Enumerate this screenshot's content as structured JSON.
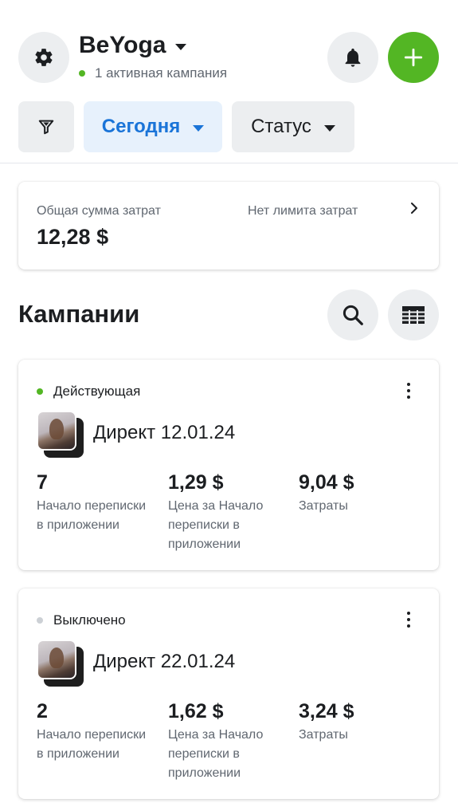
{
  "header": {
    "app_name": "BeYoga",
    "active_campaigns": "1 активная кампания",
    "settings_icon": "gear-icon",
    "notifications_icon": "bell-icon",
    "add_icon": "plus-icon"
  },
  "filters": {
    "filter_icon": "funnel-icon",
    "date_range": "Сегодня",
    "status": "Статус"
  },
  "summary": {
    "label": "Общая сумма затрат",
    "value": "12,28 $",
    "limit_text": "Нет лимита затрат"
  },
  "campaigns_section": {
    "title": "Кампании",
    "search_icon": "search-icon",
    "table_icon": "table-icon"
  },
  "campaigns": [
    {
      "status": "Действующая",
      "status_color": "#53b624",
      "name": "Директ 12.01.24",
      "metrics": [
        {
          "value": "7",
          "label": "Начало переписки в приложении"
        },
        {
          "value": "1,29 $",
          "label": "Цена за Начало переписки в приложении"
        },
        {
          "value": "9,04 $",
          "label": "Затраты"
        }
      ]
    },
    {
      "status": "Выключено",
      "status_color": "#ccd0d5",
      "name": "Директ 22.01.24",
      "metrics": [
        {
          "value": "2",
          "label": "Начало переписки в приложении"
        },
        {
          "value": "1,62 $",
          "label": "Цена за Начало переписки в приложении"
        },
        {
          "value": "3,24 $",
          "label": "Затраты"
        }
      ]
    }
  ],
  "colors": {
    "accent_blue": "#1a74d8",
    "accent_green": "#53b624",
    "text_primary": "#1c1e21",
    "text_secondary": "#606770"
  }
}
